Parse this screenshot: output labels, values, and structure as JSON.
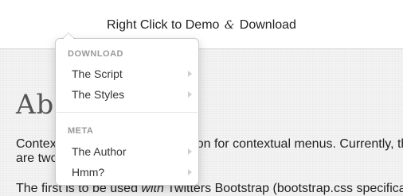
{
  "demo_bar": {
    "text_before": "Right Click to Demo",
    "ampersand": "&",
    "text_after": "Download"
  },
  "page": {
    "heading": "Abo",
    "para1_line1_left": "Contex",
    "para1_line1_right": "on for contextual menus. Currently, th",
    "para1_line2": "are two",
    "para2_start": "The first is to be used ",
    "para2_em": "with",
    "para2_end": " Twitters Bootstrap (bootstrap.css specifica"
  },
  "menu": {
    "sections": [
      {
        "header": "DOWNLOAD",
        "items": [
          {
            "label": "The Script"
          },
          {
            "label": "The Styles"
          }
        ]
      },
      {
        "header": "META",
        "items": [
          {
            "label": "The Author"
          },
          {
            "label": "Hmm?"
          }
        ]
      }
    ],
    "submenu_icon": "chevron-right-icon"
  }
}
